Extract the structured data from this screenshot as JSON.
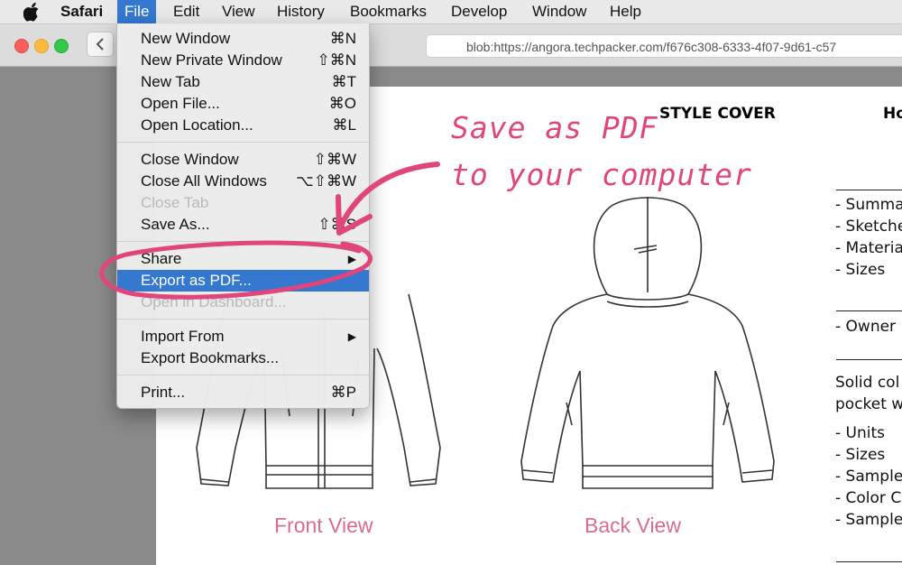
{
  "menubar": {
    "app": "Safari",
    "items": [
      "File",
      "Edit",
      "View",
      "History",
      "Bookmarks",
      "Develop",
      "Window",
      "Help"
    ]
  },
  "toolbar": {
    "url": "blob:https://angora.techpacker.com/f676c308-6333-4f07-9d61-c57"
  },
  "file_menu": {
    "new_window": {
      "label": "New Window",
      "shortcut": "⌘N"
    },
    "new_private_window": {
      "label": "New Private Window",
      "shortcut": "⇧⌘N"
    },
    "new_tab": {
      "label": "New Tab",
      "shortcut": "⌘T"
    },
    "open_file": {
      "label": "Open File...",
      "shortcut": "⌘O"
    },
    "open_location": {
      "label": "Open Location...",
      "shortcut": "⌘L"
    },
    "close_window": {
      "label": "Close Window",
      "shortcut": "⇧⌘W"
    },
    "close_all_windows": {
      "label": "Close All Windows",
      "shortcut": "⌥⇧⌘W"
    },
    "close_tab": {
      "label": "Close Tab"
    },
    "save_as": {
      "label": "Save As...",
      "shortcut": "⇧⌘S"
    },
    "share": {
      "label": "Share"
    },
    "export_pdf": {
      "label": "Export as PDF..."
    },
    "open_dashboard": {
      "label": "Open in Dashboard..."
    },
    "import_from": {
      "label": "Import From"
    },
    "export_bookmarks": {
      "label": "Export Bookmarks..."
    },
    "print": {
      "label": "Print...",
      "shortcut": "⌘P"
    }
  },
  "annotation": {
    "line1": "Save as PDF",
    "line2": "to your computer",
    "color": "#e0457b"
  },
  "document": {
    "style_cover": "STYLE COVER",
    "header_clip": "Ho",
    "front_view": "Front View",
    "back_view": "Back View",
    "list_a": [
      "- Summa",
      "- Sketche",
      "- Materia",
      "- Sizes"
    ],
    "owner": "- Owner",
    "desc": [
      "Solid col",
      "pocket w"
    ],
    "list_b": [
      "- Units",
      "- Sizes",
      "- Sample",
      "- Color C",
      "- Sample"
    ]
  },
  "colors": {
    "menu_highlight": "#3478d0",
    "view_label": "#d86c94",
    "traffic_red": "#fc605b",
    "traffic_yellow": "#fdbc40",
    "traffic_green": "#34c84a"
  }
}
